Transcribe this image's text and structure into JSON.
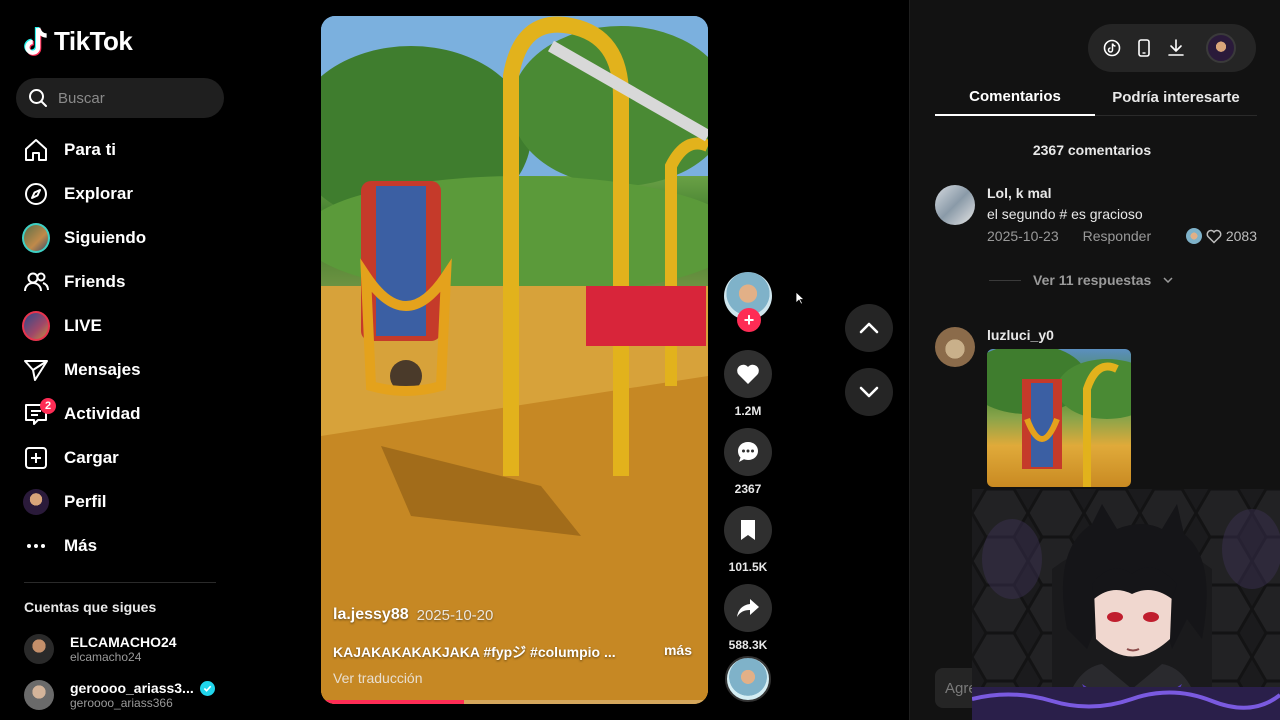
{
  "app": {
    "logo_text": "TikTok"
  },
  "search": {
    "placeholder": "Buscar"
  },
  "nav": {
    "items": [
      {
        "label": "Para ti",
        "icon": "home-icon"
      },
      {
        "label": "Explorar",
        "icon": "compass-icon"
      },
      {
        "label": "Siguiendo",
        "icon": "following-avatar"
      },
      {
        "label": "Friends",
        "icon": "friends-icon"
      },
      {
        "label": "LIVE",
        "icon": "live-avatar"
      },
      {
        "label": "Mensajes",
        "icon": "send-icon"
      },
      {
        "label": "Actividad",
        "icon": "inbox-icon",
        "badge": "2"
      },
      {
        "label": "Cargar",
        "icon": "upload-icon"
      },
      {
        "label": "Perfil",
        "icon": "profile-avatar"
      },
      {
        "label": "Más",
        "icon": "more-icon"
      }
    ]
  },
  "following": {
    "title": "Cuentas que sigues",
    "accounts": [
      {
        "name": "ELCAMACHO24",
        "handle": "elcamacho24",
        "verified": false
      },
      {
        "name": "geroooo_ariass3...",
        "handle": "geroooo_ariass366",
        "verified": true
      }
    ]
  },
  "video": {
    "author": "la.jessy88",
    "date": "2025-10-20",
    "caption": "KAJAKAKAKAKJAKA #fypジ #columpio ...",
    "more_label": "más",
    "translate_label": "Ver traducción",
    "progress": 0.37
  },
  "actions": {
    "likes": "1.2M",
    "comments": "2367",
    "saves": "101.5K",
    "shares": "588.3K"
  },
  "panel": {
    "tabs": [
      "Comentarios",
      "Podría interesarte"
    ],
    "comment_count": "2367 comentarios",
    "comments": [
      {
        "user": "Lol, k mal",
        "text": "el segundo # es gracioso",
        "date": "2025-10-23",
        "reply_label": "Responder",
        "likes": "2083"
      },
      {
        "user": "luzluci_y0"
      }
    ],
    "view_replies": "Ver 11 respuestas",
    "add_comment_placeholder": "Agre"
  },
  "colors": {
    "accent": "#fe2c55",
    "verified": "#20d5ec",
    "panel_bg": "#121212"
  }
}
